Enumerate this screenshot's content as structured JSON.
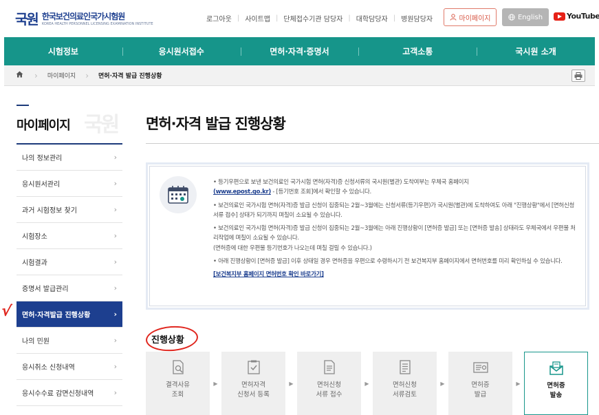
{
  "header": {
    "logo_mark": "국원",
    "logo_name": "한국보건의료인국가시험원",
    "logo_sub": "KOREA HEALTH PERSONNEL LICENSING EXAMINATION INSTITUTE",
    "util_links": [
      "로그아웃",
      "사이트맵",
      "단체접수기관 담당자",
      "대학담당자",
      "병원담당자"
    ],
    "mypage_label": "마이페이지",
    "english_label": "English",
    "youtube_label": "YouTube"
  },
  "mainnav": [
    "시험정보",
    "응시원서접수",
    "면허·자격·증명서",
    "고객소통",
    "국시원 소개"
  ],
  "breadcrumb": [
    "마이페이지",
    "면허·자격 발급 진행상황"
  ],
  "sidebar": {
    "title": "마이페이지",
    "watermark": "국원",
    "items": [
      {
        "label": "나의 정보관리"
      },
      {
        "label": "응시원서관리"
      },
      {
        "label": "과거 시험정보 찾기"
      },
      {
        "label": "시험장소"
      },
      {
        "label": "시험결과"
      },
      {
        "label": "증명서 발급관리"
      },
      {
        "label": "면허·자격발급 진행상황"
      },
      {
        "label": "나의 민원"
      },
      {
        "label": "응시취소 신청내역"
      },
      {
        "label": "응시수수료 감면신청내역"
      }
    ]
  },
  "main": {
    "title": "면허·자격 발급 진행상황",
    "notice": [
      {
        "a": "• 등기우편으로 보낸 보건의료인 국가시험 면허(자격)증 신청서류의 국시원(별관) 도착여부는 우체국 홈페이지",
        "b": "(www.epost.go.kr)",
        "c": " - [등기번호 조회]에서 확인할 수 있습니다."
      },
      {
        "a": "• 보건의료인 국가시험 면허(자격)증 발급 신청이 집중되는 2월~3월에는 신청서류(등기우편)가 국시원(별관)에 도착하여도 아래 \"진행상황\"에서 [면허신청서류 접수] 상태가 되기까지 며칠이 소요될 수 있습니다."
      },
      {
        "a": "• 보건의료인 국가시험 면허(자격)증 발급 신청이 집중되는 2월~3월에는 아래 진행상황이 [면허증 발급] 또는 [면허증 발송] 상태라도 우체국에서 우편물 처리작업에 며칠이 소요될 수 있습니다.",
        "b": "(면허증에 대한 우편물 등기번호가 나오는데 며칠 걸릴 수 있습니다.)"
      },
      {
        "a": "• 아래 진행상황이 [면허증 발급] 이후 상태일 경우 면허증을 우편으로 수령하시기 전 보건복지부 홈페이지에서 면허번호를 미리 확인하실 수 있습니다."
      }
    ],
    "notice_link": "[보건복지부 홈페이지 면허번호 확인 바로가기]",
    "progress_title": "진행상황",
    "steps": [
      {
        "line1": "결격사유",
        "line2": "조회",
        "icon": "search-doc-icon"
      },
      {
        "line1": "면허자격",
        "line2": "신청서 등록",
        "icon": "checklist-icon"
      },
      {
        "line1": "면허신청",
        "line2": "서류 접수",
        "icon": "document-icon"
      },
      {
        "line1": "면허신청",
        "line2": "서류검토",
        "icon": "review-icon"
      },
      {
        "line1": "면허증",
        "line2": "발급",
        "icon": "license-card-icon"
      },
      {
        "line1": "면허증",
        "line2": "발송",
        "icon": "envelope-icon"
      }
    ]
  },
  "colors": {
    "nav": "#16958a",
    "active": "#1d3f8f",
    "annotation": "#e0261e"
  }
}
